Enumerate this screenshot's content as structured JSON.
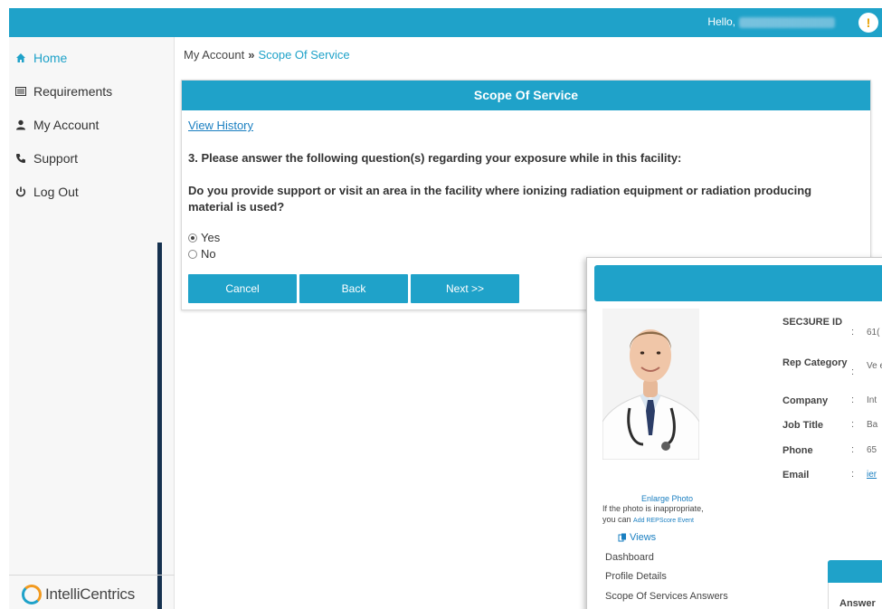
{
  "header": {
    "greeting": "Hello,",
    "user_name": "Roy Tindulat (777963)",
    "alert_icon": "!"
  },
  "sidebar": {
    "items": [
      {
        "label": "Home",
        "icon": "home-icon",
        "active": true
      },
      {
        "label": "Requirements",
        "icon": "list-icon",
        "active": false
      },
      {
        "label": "My Account",
        "icon": "user-icon",
        "active": false
      },
      {
        "label": "Support",
        "icon": "phone-icon",
        "active": false
      },
      {
        "label": "Log Out",
        "icon": "power-icon",
        "active": false
      }
    ],
    "logo_text": "IntelliCentrics"
  },
  "breadcrumb": {
    "root": "My Account",
    "separator": "»",
    "current": "Scope Of Service"
  },
  "panel": {
    "title": "Scope Of Service",
    "view_history": "View History",
    "question_intro": "3. Please answer the following question(s) regarding your exposure while in this facility:",
    "question": "Do you provide support or visit an area in the facility where ionizing radiation equipment or radiation producing material is used?",
    "options": [
      {
        "label": "Yes",
        "checked": true
      },
      {
        "label": "No",
        "checked": false
      }
    ],
    "buttons": {
      "cancel": "Cancel",
      "back": "Back",
      "next": "Next >>"
    }
  },
  "overlay": {
    "enlarge_photo": "Enlarge Photo",
    "photo_note": "If the photo is inappropriate, you can",
    "photo_note_link": "Add REPScore Event",
    "views_title": "Views",
    "views_items": [
      "Dashboard",
      "Profile Details",
      "Scope Of Services Answers"
    ],
    "info": [
      {
        "label": "SEC3URE ID",
        "value": "61("
      },
      {
        "label": "Rep Category",
        "value": "Ve exp"
      },
      {
        "label": "Company",
        "value": "Int"
      },
      {
        "label": "Job Title",
        "value": "Ba"
      },
      {
        "label": "Phone",
        "value": "65"
      },
      {
        "label": "Email",
        "value": "ier"
      }
    ],
    "info_colon": ":",
    "sub_card_text": "Answer"
  },
  "colors": {
    "brand": "#1fa2c9",
    "sidebar_bg": "#f7f7f7",
    "dark_accent": "#16314f",
    "link": "#1a7fc1"
  }
}
